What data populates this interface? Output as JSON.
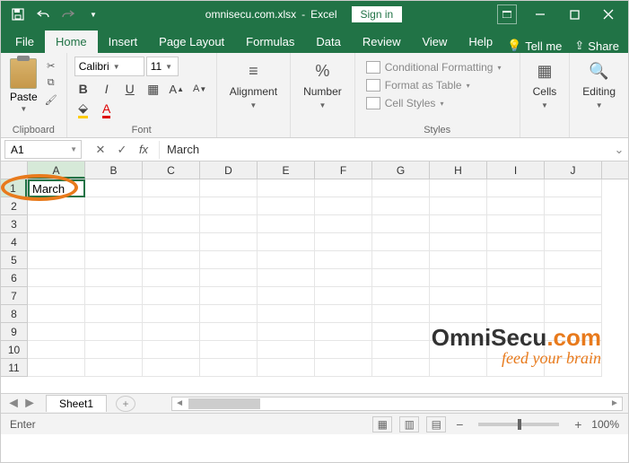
{
  "title": {
    "filename": "omnisecu.com.xlsx",
    "app": "Excel",
    "signin": "Sign in"
  },
  "tabs": {
    "file": "File",
    "home": "Home",
    "insert": "Insert",
    "pagelayout": "Page Layout",
    "formulas": "Formulas",
    "data": "Data",
    "review": "Review",
    "view": "View",
    "help": "Help",
    "tellme": "Tell me",
    "share": "Share"
  },
  "ribbon": {
    "clipboard": {
      "label": "Clipboard",
      "paste": "Paste"
    },
    "font": {
      "label": "Font",
      "name": "Calibri",
      "size": "11",
      "bold": "B",
      "italic": "I",
      "underline": "U"
    },
    "alignment": {
      "label": "Alignment"
    },
    "number": {
      "label": "Number",
      "symbol": "%"
    },
    "styles": {
      "label": "Styles",
      "cond": "Conditional Formatting",
      "table": "Format as Table",
      "cell": "Cell Styles"
    },
    "cells": {
      "label": "Cells"
    },
    "editing": {
      "label": "Editing"
    }
  },
  "formula": {
    "cell_ref": "A1",
    "value": "March"
  },
  "grid": {
    "columns": [
      "A",
      "B",
      "C",
      "D",
      "E",
      "F",
      "G",
      "H",
      "I",
      "J"
    ],
    "rows": [
      "1",
      "2",
      "3",
      "4",
      "5",
      "6",
      "7",
      "8",
      "9",
      "10",
      "11"
    ],
    "selected_cell_value": "March"
  },
  "sheet": {
    "name": "Sheet1"
  },
  "status": {
    "mode": "Enter",
    "zoom": "100%"
  },
  "watermark": {
    "brand": "OmniSecu",
    "suffix": ".com",
    "tagline": "feed your brain"
  }
}
